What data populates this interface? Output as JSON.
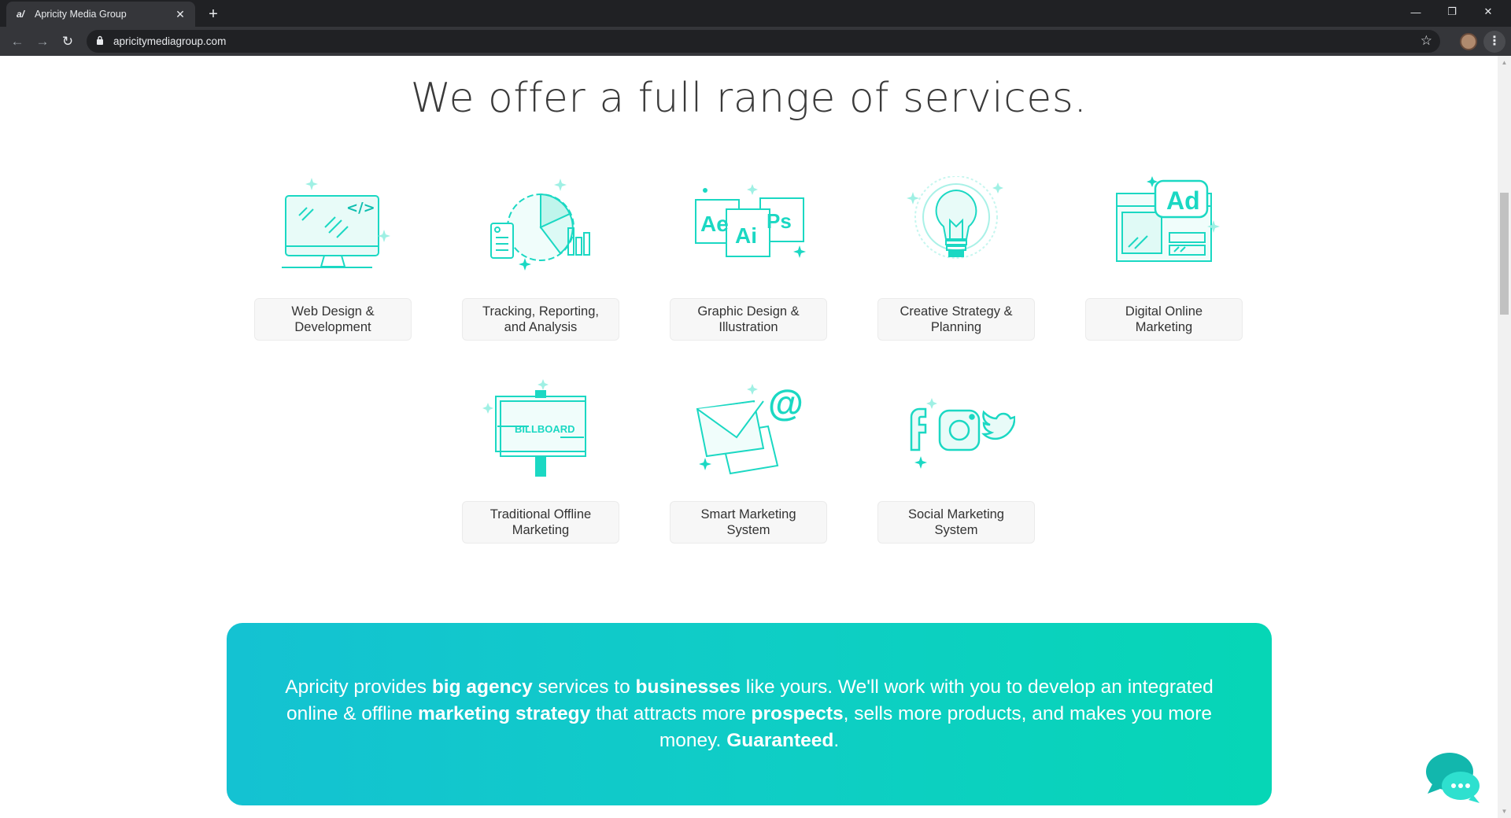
{
  "browser": {
    "tab_title": "Apricity Media Group",
    "tab_close": "✕",
    "new_tab": "+",
    "url": "apricitymediagroup.com",
    "controls": {
      "minimize": "—",
      "restore": "❐",
      "close": "✕"
    }
  },
  "page": {
    "heading": "We offer a full range of services.",
    "services": [
      {
        "label_1": "Web Design &",
        "label_2": "Development",
        "icon": "monitor-code-icon"
      },
      {
        "label_1": "Tracking, Reporting,",
        "label_2": "and Analysis",
        "icon": "pie-chart-report-icon"
      },
      {
        "label_1": "Graphic Design &",
        "label_2": "Illustration",
        "icon": "adobe-apps-icon",
        "icon_text": [
          "Ae",
          "Ai",
          "Ps"
        ]
      },
      {
        "label_1": "Creative Strategy &",
        "label_2": "Planning",
        "icon": "lightbulb-icon"
      },
      {
        "label_1": "Digital Online",
        "label_2": "Marketing",
        "icon": "ad-browser-icon",
        "icon_text": [
          "Ad"
        ]
      },
      {
        "label_1": "Traditional Offline",
        "label_2": "Marketing",
        "icon": "billboard-icon",
        "icon_text": [
          "BILLBOARD"
        ]
      },
      {
        "label_1": "Smart Marketing",
        "label_2": "System",
        "icon": "email-at-icon",
        "icon_text": [
          "@"
        ]
      },
      {
        "label_1": "Social Marketing",
        "label_2": "System",
        "icon": "social-media-icon"
      }
    ],
    "banner": {
      "t1": "Apricity provides ",
      "b1": "big agency",
      "t2": " services to ",
      "b2": "businesses",
      "t3": " like yours. We'll work with you to develop an integrated online & offline ",
      "b3": "marketing strategy",
      "t4": " that attracts more ",
      "b4": "prospects",
      "t5": ", sells more products, and makes you more money. ",
      "b5": "Guaranteed",
      "t6": "."
    }
  },
  "colors": {
    "accent": "#1bd8c3",
    "banner_start": "#14c2d2",
    "banner_end": "#06d6b6",
    "chrome_bg": "#202124"
  }
}
